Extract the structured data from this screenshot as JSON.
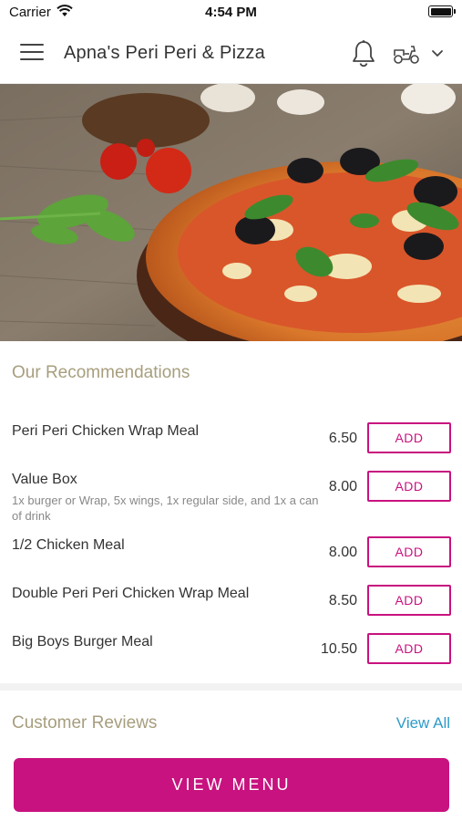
{
  "status_bar": {
    "carrier": "Carrier",
    "time": "4:54 PM"
  },
  "header": {
    "title": "Apna's Peri Peri & Pizza",
    "icons": [
      "menu-icon",
      "bell-icon",
      "scooter-icon",
      "chevron-down-icon"
    ]
  },
  "hero": {
    "image": "pizza-photo"
  },
  "recommendations": {
    "title": "Our Recommendations",
    "items": [
      {
        "name": "Peri Peri Chicken Wrap Meal",
        "description": "",
        "price": "6.50",
        "action": "ADD"
      },
      {
        "name": "Value Box",
        "description": "1x burger or Wrap, 5x wings, 1x regular side, and 1x a can of drink",
        "price": "8.00",
        "action": "ADD"
      },
      {
        "name": "1/2 Chicken Meal",
        "description": "",
        "price": "8.00",
        "action": "ADD"
      },
      {
        "name": "Double Peri Peri Chicken Wrap Meal",
        "description": "",
        "price": "8.50",
        "action": "ADD"
      },
      {
        "name": "Big Boys Burger Meal",
        "description": "",
        "price": "10.50",
        "action": "ADD"
      }
    ]
  },
  "reviews": {
    "title": "Customer Reviews",
    "view_all": "View All"
  },
  "footer": {
    "view_menu": "VIEW MENU"
  },
  "colors": {
    "accent": "#c8127f",
    "section_title": "#a79e7e",
    "link": "#2e9bc9"
  }
}
